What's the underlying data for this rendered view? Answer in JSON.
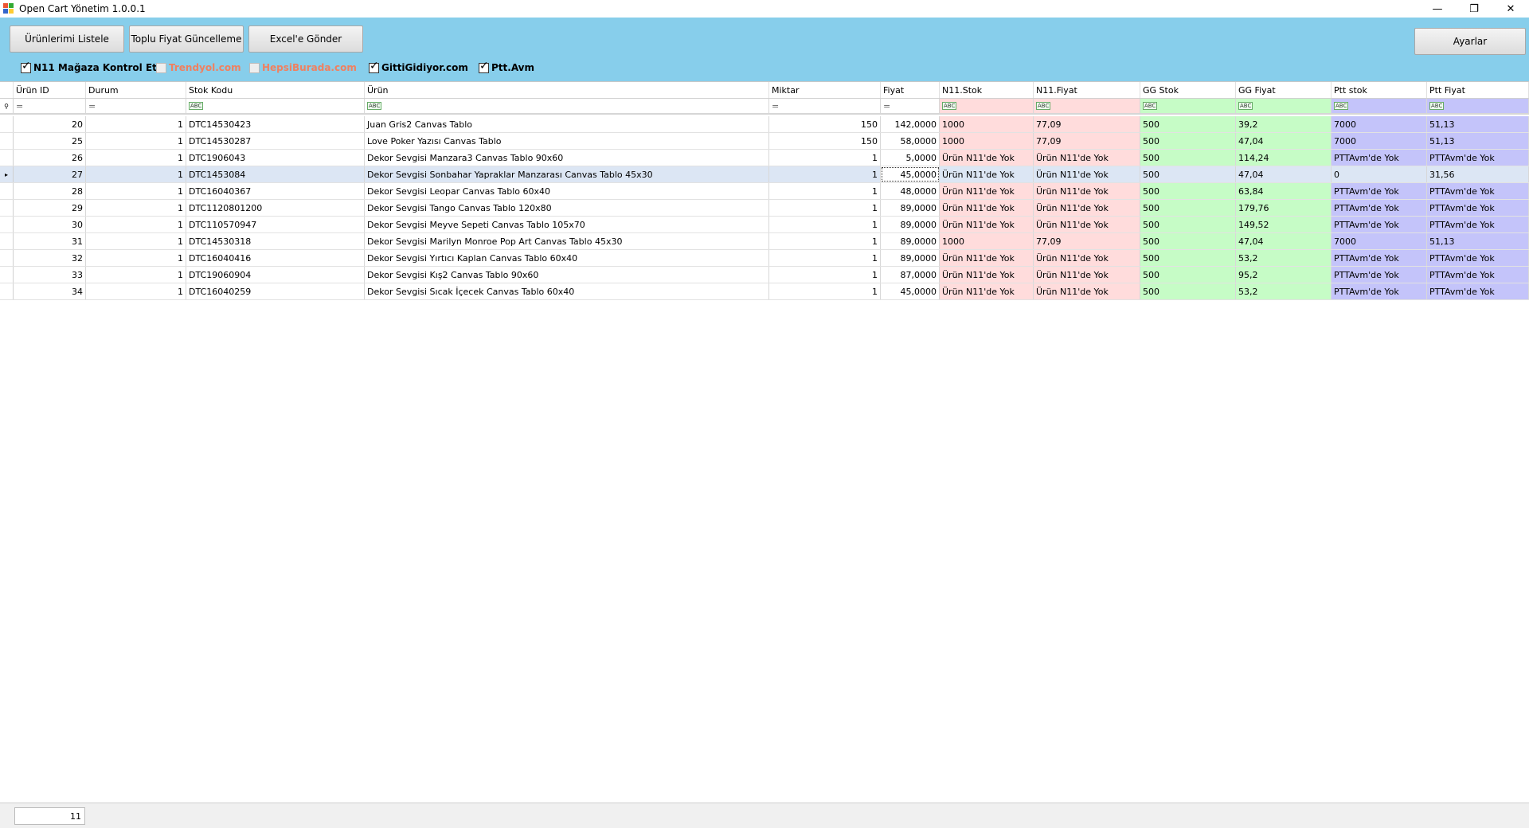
{
  "window": {
    "title": "Open Cart Yönetim 1.0.0.1",
    "minimize": "—",
    "restore": "❐",
    "close": "✕"
  },
  "toolbar": {
    "list_label": "Ürünlerimi Listele",
    "bulk_price_label": "Toplu Fiyat Güncelleme",
    "excel_label": "Excel'e Gönder",
    "settings_label": "Ayarlar"
  },
  "checkboxes": {
    "n11": {
      "label": "N11 Mağaza Kontrol Et.",
      "checked": true
    },
    "trendyol": {
      "label": "Trendyol.com",
      "checked": false
    },
    "hepsiburada": {
      "label": "HepsiBurada.com",
      "checked": false
    },
    "gittigidiyor": {
      "label": "GittiGidiyor.com",
      "checked": true
    },
    "ptt": {
      "label": "Ptt.Avm",
      "checked": true
    }
  },
  "grid": {
    "columns": [
      "Ürün ID",
      "Durum",
      "Stok Kodu",
      "Ürün",
      "Miktar",
      "Fiyat",
      "N11.Stok",
      "N11.Fiyat",
      "GG Stok",
      "GG Fiyat",
      "Ptt stok",
      "Ptt Fiyat"
    ],
    "filter_eq": "=",
    "filter_abc": "ABC",
    "rows": [
      [
        "20",
        "1",
        "DTC14530423",
        "Juan Gris2 Canvas Tablo",
        "150",
        "142,0000",
        "1000",
        "77,09",
        "500",
        "39,2",
        "7000",
        "51,13"
      ],
      [
        "25",
        "1",
        "DTC14530287",
        "Love Poker Yazısı Canvas Tablo",
        "150",
        "58,0000",
        "1000",
        "77,09",
        "500",
        "47,04",
        "7000",
        "51,13"
      ],
      [
        "26",
        "1",
        "DTC1906043",
        "Dekor Sevgisi Manzara3 Canvas Tablo 90x60",
        "1",
        "5,0000",
        "Ürün N11'de Yok",
        "Ürün N11'de Yok",
        "500",
        "114,24",
        "PTTAvm'de Yok",
        "PTTAvm'de Yok"
      ],
      [
        "27",
        "1",
        "DTC1453084",
        "Dekor Sevgisi Sonbahar Yapraklar Manzarası Canvas Tablo 45x30",
        "1",
        "45,0000",
        "Ürün N11'de Yok",
        "Ürün N11'de Yok",
        "500",
        "47,04",
        "0",
        "31,56"
      ],
      [
        "28",
        "1",
        "DTC16040367",
        "Dekor Sevgisi Leopar Canvas Tablo 60x40",
        "1",
        "48,0000",
        "Ürün N11'de Yok",
        "Ürün N11'de Yok",
        "500",
        "63,84",
        "PTTAvm'de Yok",
        "PTTAvm'de Yok"
      ],
      [
        "29",
        "1",
        "DTC1120801200",
        "Dekor Sevgisi Tango Canvas Tablo 120x80",
        "1",
        "89,0000",
        "Ürün N11'de Yok",
        "Ürün N11'de Yok",
        "500",
        "179,76",
        "PTTAvm'de Yok",
        "PTTAvm'de Yok"
      ],
      [
        "30",
        "1",
        "DTC110570947",
        "Dekor Sevgisi Meyve Sepeti Canvas Tablo 105x70",
        "1",
        "89,0000",
        "Ürün N11'de Yok",
        "Ürün N11'de Yok",
        "500",
        "149,52",
        "PTTAvm'de Yok",
        "PTTAvm'de Yok"
      ],
      [
        "31",
        "1",
        "DTC14530318",
        "Dekor Sevgisi Marilyn Monroe Pop Art Canvas Tablo 45x30",
        "1",
        "89,0000",
        "1000",
        "77,09",
        "500",
        "47,04",
        "7000",
        "51,13"
      ],
      [
        "32",
        "1",
        "DTC16040416",
        "Dekor Sevgisi Yırtıcı Kaplan Canvas Tablo 60x40",
        "1",
        "89,0000",
        "Ürün N11'de Yok",
        "Ürün N11'de Yok",
        "500",
        "53,2",
        "PTTAvm'de Yok",
        "PTTAvm'de Yok"
      ],
      [
        "33",
        "1",
        "DTC19060904",
        "Dekor Sevgisi Kış2 Canvas Tablo 90x60",
        "1",
        "87,0000",
        "Ürün N11'de Yok",
        "Ürün N11'de Yok",
        "500",
        "95,2",
        "PTTAvm'de Yok",
        "PTTAvm'de Yok"
      ],
      [
        "34",
        "1",
        "DTC16040259",
        "Dekor Sevgisi Sıcak İçecek Canvas Tablo 60x40",
        "1",
        "45,0000",
        "Ürün N11'de Yok",
        "Ürün N11'de Yok",
        "500",
        "53,2",
        "PTTAvm'de Yok",
        "PTTAvm'de Yok"
      ]
    ],
    "selected_row_index": 3
  },
  "status": {
    "count": "11"
  },
  "colors": {
    "toolbar_bg": "#87ceeb",
    "n11_bg": "#ffdcdc",
    "gg_bg": "#c6fcc6",
    "ptt_bg": "#c4c4fa",
    "selected_bg": "#dce6f4"
  }
}
